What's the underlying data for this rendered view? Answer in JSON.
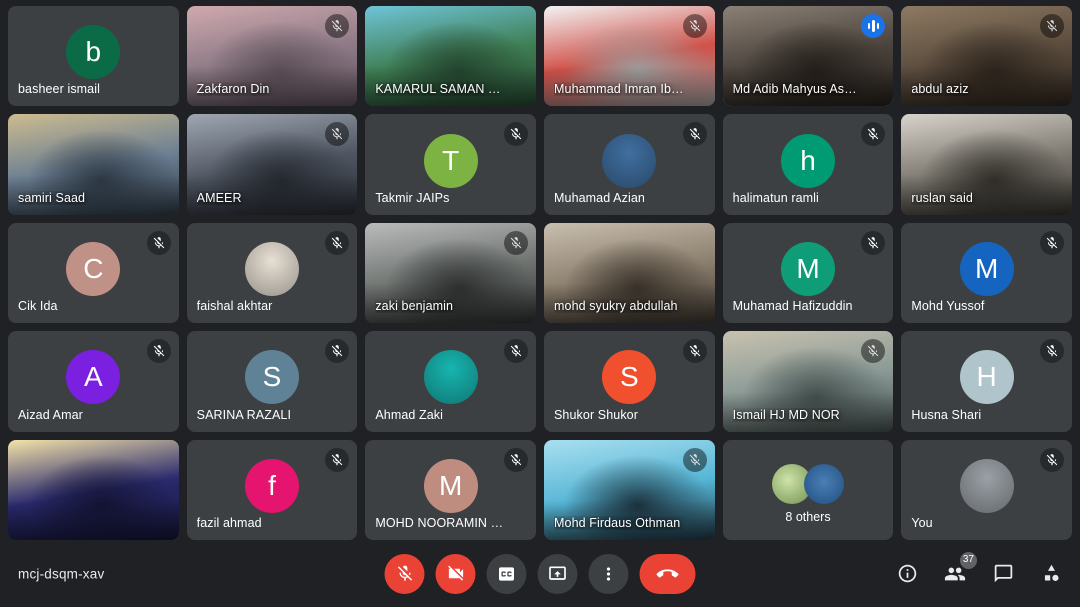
{
  "meeting": {
    "code": "mcj-dsqm-xav",
    "participant_count": "37"
  },
  "colors": {
    "accent_blue": "#1a73e8",
    "speaking_border": "#8ab4f8",
    "danger_red": "#ea4335",
    "tile_bg": "#3c4043",
    "page_bg": "#202124"
  },
  "tiles": [
    {
      "name": "basheer ismail",
      "kind": "avatar",
      "initial": "b",
      "avatar_color": "#0b6b46",
      "muted": false,
      "speaking": false
    },
    {
      "name": "Zakfaron Din",
      "kind": "video",
      "muted": true,
      "speaking": false,
      "v1": "#cfa9ae",
      "v2": "#8d7a86",
      "v3": "#5c4f58"
    },
    {
      "name": "KAMARUL SAMAN YAAC...",
      "kind": "video",
      "muted": false,
      "speaking": false,
      "v1": "#6fc4d8",
      "v2": "#3f7f54",
      "v3": "#24452f"
    },
    {
      "name": "Muhammad Imran Ibrahim",
      "kind": "video",
      "muted": true,
      "speaking": false,
      "v1": "#f3f3f3",
      "v2": "#d0524a",
      "v3": "#9c9c9c"
    },
    {
      "name": "Md Adib Mahyus Asmungi",
      "kind": "video",
      "muted": false,
      "speaking": true,
      "v1": "#8b8075",
      "v2": "#4b443d",
      "v3": "#241f1b"
    },
    {
      "name": "abdul aziz",
      "kind": "video",
      "muted": true,
      "speaking": false,
      "v1": "#8e7a63",
      "v2": "#5b4c3d",
      "v3": "#2d251d"
    },
    {
      "name": "samiri Saad",
      "kind": "video",
      "muted": false,
      "speaking": false,
      "v1": "#cdbc8f",
      "v2": "#6c7f93",
      "v3": "#2e3a46"
    },
    {
      "name": "AMEER",
      "kind": "video",
      "muted": true,
      "speaking": false,
      "v1": "#9fa7b3",
      "v2": "#4f5662",
      "v3": "#262a31"
    },
    {
      "name": "Takmir JAIPs",
      "kind": "avatar",
      "initial": "T",
      "avatar_color": "#7cb342",
      "muted": true,
      "speaking": false
    },
    {
      "name": "Muhamad Azian",
      "kind": "avatar",
      "initial": "",
      "avatar_color": "#3f6fa0",
      "muted": true,
      "speaking": false,
      "avatar_photo": true
    },
    {
      "name": "halimatun ramli",
      "kind": "avatar",
      "initial": "h",
      "avatar_color": "#009b72",
      "muted": true,
      "speaking": false
    },
    {
      "name": "ruslan said",
      "kind": "video",
      "muted": false,
      "speaking": false,
      "v1": "#d8d4cc",
      "v2": "#7e7a72",
      "v3": "#33302b"
    },
    {
      "name": "Cik Ida",
      "kind": "avatar",
      "initial": "C",
      "avatar_color": "#c09187",
      "muted": true,
      "speaking": false
    },
    {
      "name": "faishal akhtar",
      "kind": "avatar",
      "initial": "",
      "avatar_color": "#e8e0d4",
      "muted": true,
      "speaking": false,
      "avatar_photo": true
    },
    {
      "name": "zaki benjamin",
      "kind": "video",
      "muted": true,
      "speaking": false,
      "v1": "#b9bcbb",
      "v2": "#6f7370",
      "v3": "#2e3130"
    },
    {
      "name": "mohd syukry abdullah",
      "kind": "video",
      "muted": false,
      "speaking": false,
      "v1": "#c9bfae",
      "v2": "#8b7f6e",
      "v3": "#3a332b"
    },
    {
      "name": "Muhamad Hafizuddin",
      "kind": "avatar",
      "initial": "M",
      "avatar_color": "#0f9d77",
      "muted": true,
      "speaking": false
    },
    {
      "name": "Mohd Yussof",
      "kind": "avatar",
      "initial": "M",
      "avatar_color": "#1565c0",
      "muted": true,
      "speaking": false
    },
    {
      "name": "Aizad Amar",
      "kind": "avatar",
      "initial": "A",
      "avatar_color": "#7b1fe0",
      "muted": true,
      "speaking": false
    },
    {
      "name": "SARINA RAZALI",
      "kind": "avatar",
      "initial": "S",
      "avatar_color": "#5f8296",
      "muted": true,
      "speaking": false
    },
    {
      "name": "Ahmad Zaki",
      "kind": "avatar",
      "initial": "",
      "avatar_color": "#18b5b0",
      "muted": true,
      "speaking": false,
      "avatar_photo": true
    },
    {
      "name": "Shukor Shukor",
      "kind": "avatar",
      "initial": "S",
      "avatar_color": "#f0502d",
      "muted": true,
      "speaking": false
    },
    {
      "name": "Ismail HJ MD NOR",
      "kind": "video",
      "muted": true,
      "speaking": false,
      "v1": "#c8c2b0",
      "v2": "#8b9a96",
      "v3": "#44504e"
    },
    {
      "name": "Husna Shari",
      "kind": "avatar",
      "initial": "H",
      "avatar_color": "#b0c4cc",
      "muted": true,
      "speaking": false
    },
    {
      "name": "",
      "kind": "video",
      "muted": false,
      "speaking": false,
      "v1": "#f4e3a8",
      "v2": "#2a2a6e",
      "v3": "#141436"
    },
    {
      "name": "fazil ahmad",
      "kind": "avatar",
      "initial": "f",
      "avatar_color": "#e5156f",
      "muted": true,
      "speaking": false
    },
    {
      "name": "MOHD NOORAMIN ZAINA...",
      "kind": "avatar",
      "initial": "M",
      "avatar_color": "#bf8d80",
      "muted": true,
      "speaking": false
    },
    {
      "name": "Mohd Firdaus Othman",
      "kind": "video",
      "muted": true,
      "speaking": false,
      "v1": "#a9dff0",
      "v2": "#56b6d6",
      "v3": "#1e3440"
    },
    {
      "name": "8 others",
      "kind": "others",
      "muted": false,
      "speaking": false
    },
    {
      "name": "You",
      "kind": "avatar",
      "initial": "",
      "avatar_color": "#9aa0a6",
      "muted": true,
      "speaking": false,
      "avatar_photo": true
    }
  ],
  "controls": [
    {
      "id": "mic",
      "label": "Turn on microphone",
      "icon": "mic-off-icon",
      "style": "danger"
    },
    {
      "id": "camera",
      "label": "Turn on camera",
      "icon": "camera-off-icon",
      "style": "danger"
    },
    {
      "id": "captions",
      "label": "Turn on captions",
      "icon": "cc-icon",
      "style": "neutral"
    },
    {
      "id": "present",
      "label": "Present now",
      "icon": "present-icon",
      "style": "neutral"
    },
    {
      "id": "more",
      "label": "More options",
      "icon": "more-vert-icon",
      "style": "neutral"
    },
    {
      "id": "hangup",
      "label": "Leave call",
      "icon": "end-call-icon",
      "style": "hangup"
    }
  ],
  "right_icons": [
    {
      "id": "info",
      "label": "Meeting details",
      "icon": "info-icon"
    },
    {
      "id": "participants",
      "label": "Show everyone",
      "icon": "people-icon",
      "badge": "37"
    },
    {
      "id": "chat",
      "label": "Chat with everyone",
      "icon": "chat-icon"
    },
    {
      "id": "activities",
      "label": "Activities",
      "icon": "activities-icon"
    }
  ]
}
